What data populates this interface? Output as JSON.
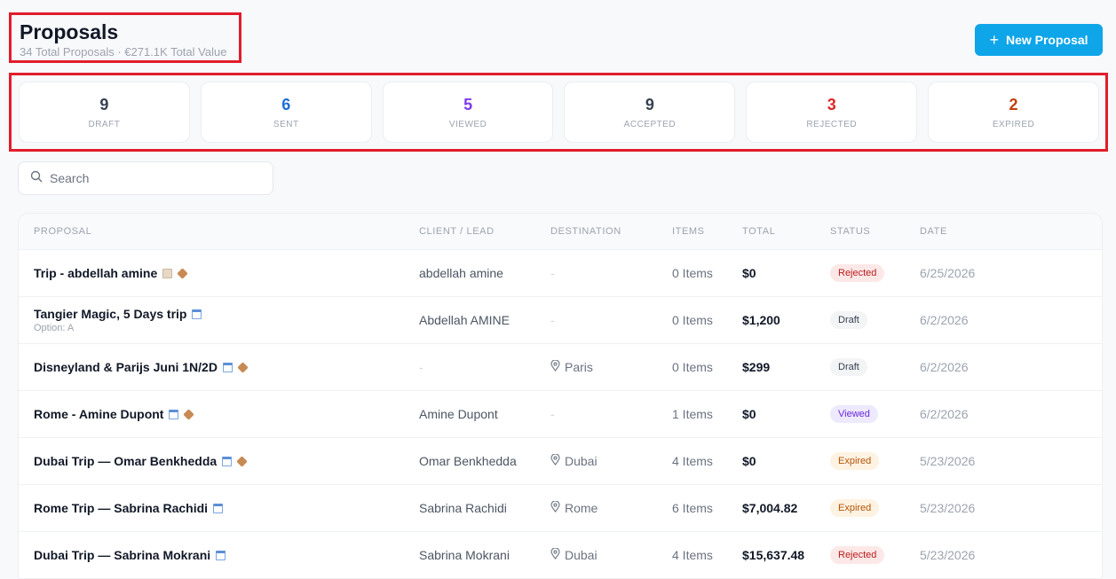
{
  "header": {
    "title": "Proposals",
    "subtitle": "34 Total Proposals · €271.1K Total Value"
  },
  "new_button": {
    "label": "New Proposal",
    "icon": "plus-icon"
  },
  "stats": [
    {
      "value": "9",
      "label": "DRAFT",
      "color": "#374151"
    },
    {
      "value": "6",
      "label": "SENT",
      "color": "#1d6fd8"
    },
    {
      "value": "5",
      "label": "VIEWED",
      "color": "#7c3aed"
    },
    {
      "value": "9",
      "label": "ACCEPTED",
      "color": "#374151"
    },
    {
      "value": "3",
      "label": "REJECTED",
      "color": "#dc2626"
    },
    {
      "value": "2",
      "label": "EXPIRED",
      "color": "#c2410c"
    }
  ],
  "search": {
    "placeholder": "Search",
    "icon": "search-icon"
  },
  "table": {
    "columns": [
      "PROPOSAL",
      "CLIENT / LEAD",
      "DESTINATION",
      "ITEMS",
      "TOTAL",
      "STATUS",
      "DATE"
    ],
    "rows": [
      {
        "name": "Trip - abdellah amine",
        "sub": "",
        "icons": [
          "note-icon",
          "package-icon"
        ],
        "client": "abdellah amine",
        "destination": "-",
        "items": "0 Items",
        "total": "$0",
        "status": "Rejected",
        "date": "6/25/2026"
      },
      {
        "name": "Tangier Magic, 5 Days trip",
        "sub": "Option: A",
        "icons": [
          "calendar-icon"
        ],
        "client": "Abdellah AMINE",
        "destination": "-",
        "items": "0 Items",
        "total": "$1,200",
        "status": "Draft",
        "date": "6/2/2026"
      },
      {
        "name": "Disneyland & Parijs Juni 1N/2D",
        "sub": "",
        "icons": [
          "calendar-icon",
          "package-icon"
        ],
        "client": "-",
        "destination": "Paris",
        "items": "0 Items",
        "total": "$299",
        "status": "Draft",
        "date": "6/2/2026"
      },
      {
        "name": "Rome - Amine Dupont",
        "sub": "",
        "icons": [
          "calendar-icon",
          "package-icon"
        ],
        "client": "Amine Dupont",
        "destination": "-",
        "items": "1 Items",
        "total": "$0",
        "status": "Viewed",
        "date": "6/2/2026"
      },
      {
        "name": "Dubai Trip — Omar Benkhedda",
        "sub": "",
        "icons": [
          "calendar-icon",
          "package-icon"
        ],
        "client": "Omar Benkhedda",
        "destination": "Dubai",
        "items": "4 Items",
        "total": "$0",
        "status": "Expired",
        "date": "5/23/2026"
      },
      {
        "name": "Rome Trip — Sabrina Rachidi",
        "sub": "",
        "icons": [
          "calendar-icon"
        ],
        "client": "Sabrina Rachidi",
        "destination": "Rome",
        "items": "6 Items",
        "total": "$7,004.82",
        "status": "Expired",
        "date": "5/23/2026"
      },
      {
        "name": "Dubai Trip — Sabrina Mokrani",
        "sub": "",
        "icons": [
          "calendar-icon"
        ],
        "client": "Sabrina Mokrani",
        "destination": "Dubai",
        "items": "4 Items",
        "total": "$15,637.48",
        "status": "Rejected",
        "date": "5/23/2026"
      }
    ]
  }
}
